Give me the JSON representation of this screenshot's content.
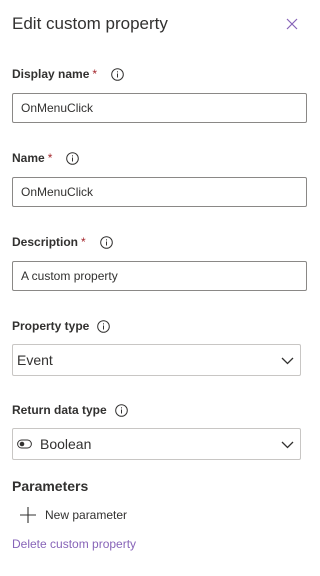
{
  "panel": {
    "title": "Edit custom property",
    "close_icon": "close-icon"
  },
  "fields": {
    "display_name": {
      "label": "Display name",
      "required_mark": "*",
      "value": "OnMenuClick"
    },
    "name": {
      "label": "Name",
      "required_mark": "*",
      "value": "OnMenuClick"
    },
    "description": {
      "label": "Description",
      "required_mark": "*",
      "value": "A custom property"
    },
    "property_type": {
      "label": "Property type",
      "selected": "Event"
    },
    "return_data_type": {
      "label": "Return data type",
      "selected": "Boolean",
      "icon": "toggle-icon"
    }
  },
  "parameters": {
    "heading": "Parameters",
    "new_parameter_label": "New parameter"
  },
  "delete_link": "Delete custom property",
  "colors": {
    "required": "#a4262c",
    "accent": "#8764b8",
    "text": "#323130",
    "border": "#8a8886"
  }
}
